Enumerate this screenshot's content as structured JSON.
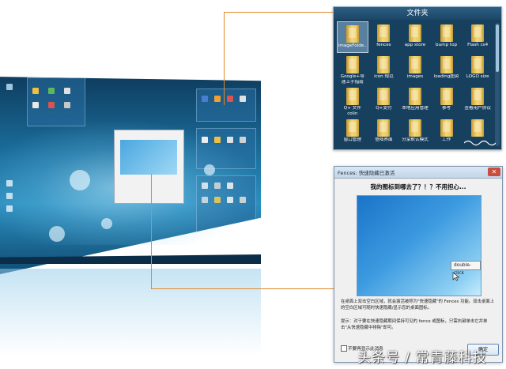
{
  "folder_window": {
    "title": "文件夹",
    "items": [
      {
        "label": "imageFolde..",
        "selected": true
      },
      {
        "label": "fences"
      },
      {
        "label": "app store"
      },
      {
        "label": "bump top"
      },
      {
        "label": "Flash cs4"
      },
      {
        "label": "Google+导"
      },
      {
        "label": "icon 规范"
      },
      {
        "label": "images"
      },
      {
        "label": "loading图资"
      },
      {
        "label": "LOGO size"
      },
      {
        "label": "Q+ 文件"
      },
      {
        "label": "Q+支付"
      },
      {
        "label": "本地应用管理"
      },
      {
        "label": "参考"
      },
      {
        "label": "查看用户协议"
      },
      {
        "label": "窗口管理"
      },
      {
        "label": "登陆界面"
      },
      {
        "label": "分享默认模式"
      },
      {
        "label": "工作"
      },
      {
        "label": ""
      }
    ],
    "extra_labels": [
      "速上手指南",
      "colin"
    ]
  },
  "fences_dialog": {
    "title": "Fences: 快速隐藏已激活",
    "close_glyph": "✕",
    "heading": "我的图标到哪去了？！？不用担心...",
    "tooltip": "double-click",
    "paragraph1": "在桌面上双击空白区域，就会激活被称为\"快速隐藏\"的 Fences 功能。双击桌面上的空白区域可随时快速隐藏/显示您的桌面图标。",
    "paragraph2": "提示：对于要在快速隐藏期间保持可见的 fence 或图标，只需右键单击它并单击\"从快速隐藏中排除\"即可。",
    "checkbox_label": "不要再显示此消息",
    "ok_label": "确定"
  },
  "watermark": "头条号 / 常青藤科技",
  "colors": {
    "connector": "#e08a2a",
    "folder_bg": "#173f5e",
    "desktop": "#1a6e9c"
  }
}
